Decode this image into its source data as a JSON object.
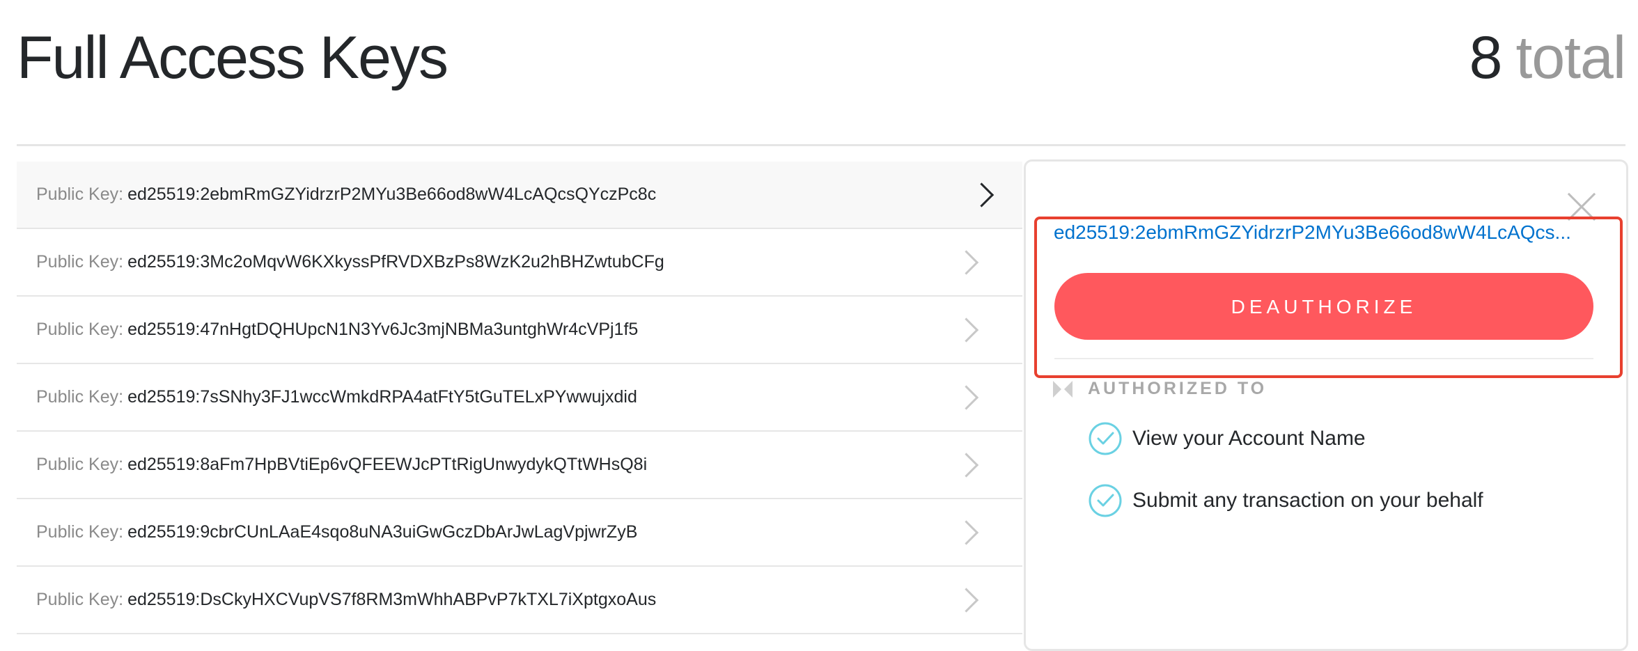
{
  "header": {
    "title": "Full Access Keys",
    "total_count": "8",
    "total_label": "total"
  },
  "keys": [
    {
      "prefix": "Public Key:",
      "value": "ed25519:2ebmRmGZYidrzrP2MYu3Be66od8wW4LcAQcsQYczPc8c",
      "selected": true
    },
    {
      "prefix": "Public Key:",
      "value": "ed25519:3Mc2oMqvW6KXkyssPfRVDXBzPs8WzK2u2hBHZwtubCFg",
      "selected": false
    },
    {
      "prefix": "Public Key:",
      "value": "ed25519:47nHgtDQHUpcN1N3Yv6Jc3mjNBMa3untghWr4cVPj1f5",
      "selected": false
    },
    {
      "prefix": "Public Key:",
      "value": "ed25519:7sSNhy3FJ1wccWmkdRPA4atFtY5tGuTELxPYwwujxdid",
      "selected": false
    },
    {
      "prefix": "Public Key:",
      "value": "ed25519:8aFm7HpBVtiEp6vQFEEWJcPTtRigUnwydykQTtWHsQ8i",
      "selected": false
    },
    {
      "prefix": "Public Key:",
      "value": "ed25519:9cbrCUnLAaE4sqo8uNA3uiGwGczDbArJwLagVpjwrZyB",
      "selected": false
    },
    {
      "prefix": "Public Key:",
      "value": "ed25519:DsCkyHXCVupVS7f8RM3mWhhABPvP7kTXL7iXptgxoAus",
      "selected": false
    }
  ],
  "detail": {
    "key_display": "ed25519:2ebmRmGZYidrzrP2MYu3Be66od8wW4LcAQcs...",
    "deauthorize_label": "DEAUTHORIZE",
    "authorized_heading": "AUTHORIZED TO",
    "permissions": [
      {
        "label": "View your Account Name",
        "icon": "check-circle-icon"
      },
      {
        "label": "Submit any transaction on your behalf",
        "icon": "check-circle-icon"
      }
    ]
  },
  "colors": {
    "accent_blue": "#0072ce",
    "deauthorize_red": "#ff585d",
    "highlight_red": "#e8402f",
    "check_teal": "#6ad1e3"
  }
}
